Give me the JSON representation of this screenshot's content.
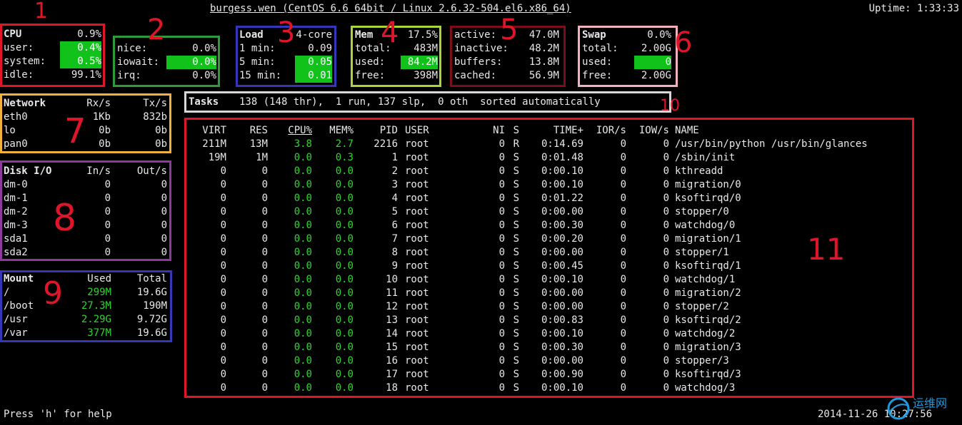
{
  "header": {
    "title": "burgess.wen (CentOS 6.6 64bit / Linux 2.6.32-504.el6.x86_64)",
    "uptime": "Uptime: 1:33:33"
  },
  "cpu": {
    "label": "CPU",
    "total": "0.9%",
    "rows": [
      {
        "k": "user:",
        "v": "0.4%"
      },
      {
        "k": "system:",
        "v": "0.5%"
      },
      {
        "k": "idle:",
        "v": "99.1%"
      }
    ]
  },
  "cpu2": {
    "rows": [
      {
        "k": "nice:",
        "v": "0.0%"
      },
      {
        "k": "iowait:",
        "v": "0.0%"
      },
      {
        "k": "irq:",
        "v": "0.0%"
      }
    ]
  },
  "load": {
    "label": "Load",
    "cores": "4-core",
    "rows": [
      {
        "k": "1 min:",
        "v": "0.09"
      },
      {
        "k": "5 min:",
        "v": "0.05"
      },
      {
        "k": "15 min:",
        "v": "0.01"
      }
    ]
  },
  "mem": {
    "label": "Mem",
    "pct": "17.5%",
    "rows": [
      {
        "k": "total:",
        "v": "483M"
      },
      {
        "k": "used:",
        "v": "84.2M"
      },
      {
        "k": "free:",
        "v": "398M"
      }
    ]
  },
  "mem2": {
    "rows": [
      {
        "k": "active:",
        "v": "47.0M"
      },
      {
        "k": "inactive:",
        "v": "48.2M"
      },
      {
        "k": "buffers:",
        "v": "13.8M"
      },
      {
        "k": "cached:",
        "v": "56.9M"
      }
    ]
  },
  "swap": {
    "label": "Swap",
    "pct": "0.0%",
    "rows": [
      {
        "k": "total:",
        "v": "2.00G"
      },
      {
        "k": "used:",
        "v": "0"
      },
      {
        "k": "free:",
        "v": "2.00G"
      }
    ]
  },
  "network": {
    "label": "Network",
    "rx": "Rx/s",
    "tx": "Tx/s",
    "rows": [
      {
        "k": "eth0",
        "rx": "1Kb",
        "tx": "832b"
      },
      {
        "k": "lo",
        "rx": "0b",
        "tx": "0b"
      },
      {
        "k": "pan0",
        "rx": "0b",
        "tx": "0b"
      }
    ]
  },
  "disk": {
    "label": "Disk I/O",
    "in": "In/s",
    "out": "Out/s",
    "rows": [
      {
        "k": "dm-0",
        "i": "0",
        "o": "0"
      },
      {
        "k": "dm-1",
        "i": "0",
        "o": "0"
      },
      {
        "k": "dm-2",
        "i": "0",
        "o": "0"
      },
      {
        "k": "dm-3",
        "i": "0",
        "o": "0"
      },
      {
        "k": "sda1",
        "i": "0",
        "o": "0"
      },
      {
        "k": "sda2",
        "i": "0",
        "o": "0"
      }
    ]
  },
  "mount": {
    "label": "Mount",
    "used": "Used",
    "total": "Total",
    "rows": [
      {
        "k": "/",
        "u": "299M",
        "t": "19.6G"
      },
      {
        "k": "/boot",
        "u": "27.3M",
        "t": "190M"
      },
      {
        "k": "/usr",
        "u": "2.29G",
        "t": "9.72G"
      },
      {
        "k": "/var",
        "u": "377M",
        "t": "19.6G"
      }
    ]
  },
  "tasks": {
    "label": "Tasks",
    "text": "138 (148 thr),  1 run, 137 slp,  0 oth  sorted automatically"
  },
  "proc": {
    "headers": {
      "virt": "VIRT",
      "res": "RES",
      "cpu": "CPU%",
      "mem": "MEM%",
      "pid": "PID",
      "user": "USER",
      "ni": "NI",
      "s": "S",
      "time": "TIME+",
      "ior": "IOR/s",
      "iow": "IOW/s",
      "name": "NAME"
    },
    "rows": [
      {
        "virt": "211M",
        "res": "13M",
        "cpu": "3.8",
        "mem": "2.7",
        "pid": "2216",
        "user": "root",
        "ni": "0",
        "s": "R",
        "time": "0:14.69",
        "ior": "0",
        "iow": "0",
        "name": "/usr/bin/python /usr/bin/glances"
      },
      {
        "virt": "19M",
        "res": "1M",
        "cpu": "0.0",
        "mem": "0.3",
        "pid": "1",
        "user": "root",
        "ni": "0",
        "s": "S",
        "time": "0:01.48",
        "ior": "0",
        "iow": "0",
        "name": "/sbin/init"
      },
      {
        "virt": "0",
        "res": "0",
        "cpu": "0.0",
        "mem": "0.0",
        "pid": "2",
        "user": "root",
        "ni": "0",
        "s": "S",
        "time": "0:00.10",
        "ior": "0",
        "iow": "0",
        "name": "kthreadd"
      },
      {
        "virt": "0",
        "res": "0",
        "cpu": "0.0",
        "mem": "0.0",
        "pid": "3",
        "user": "root",
        "ni": "0",
        "s": "S",
        "time": "0:00.10",
        "ior": "0",
        "iow": "0",
        "name": "migration/0"
      },
      {
        "virt": "0",
        "res": "0",
        "cpu": "0.0",
        "mem": "0.0",
        "pid": "4",
        "user": "root",
        "ni": "0",
        "s": "S",
        "time": "0:01.22",
        "ior": "0",
        "iow": "0",
        "name": "ksoftirqd/0"
      },
      {
        "virt": "0",
        "res": "0",
        "cpu": "0.0",
        "mem": "0.0",
        "pid": "5",
        "user": "root",
        "ni": "0",
        "s": "S",
        "time": "0:00.00",
        "ior": "0",
        "iow": "0",
        "name": "stopper/0"
      },
      {
        "virt": "0",
        "res": "0",
        "cpu": "0.0",
        "mem": "0.0",
        "pid": "6",
        "user": "root",
        "ni": "0",
        "s": "S",
        "time": "0:00.30",
        "ior": "0",
        "iow": "0",
        "name": "watchdog/0"
      },
      {
        "virt": "0",
        "res": "0",
        "cpu": "0.0",
        "mem": "0.0",
        "pid": "7",
        "user": "root",
        "ni": "0",
        "s": "S",
        "time": "0:00.20",
        "ior": "0",
        "iow": "0",
        "name": "migration/1"
      },
      {
        "virt": "0",
        "res": "0",
        "cpu": "0.0",
        "mem": "0.0",
        "pid": "8",
        "user": "root",
        "ni": "0",
        "s": "S",
        "time": "0:00.00",
        "ior": "0",
        "iow": "0",
        "name": "stopper/1"
      },
      {
        "virt": "0",
        "res": "0",
        "cpu": "0.0",
        "mem": "0.0",
        "pid": "9",
        "user": "root",
        "ni": "0",
        "s": "S",
        "time": "0:00.45",
        "ior": "0",
        "iow": "0",
        "name": "ksoftirqd/1"
      },
      {
        "virt": "0",
        "res": "0",
        "cpu": "0.0",
        "mem": "0.0",
        "pid": "10",
        "user": "root",
        "ni": "0",
        "s": "S",
        "time": "0:00.10",
        "ior": "0",
        "iow": "0",
        "name": "watchdog/1"
      },
      {
        "virt": "0",
        "res": "0",
        "cpu": "0.0",
        "mem": "0.0",
        "pid": "11",
        "user": "root",
        "ni": "0",
        "s": "S",
        "time": "0:00.00",
        "ior": "0",
        "iow": "0",
        "name": "migration/2"
      },
      {
        "virt": "0",
        "res": "0",
        "cpu": "0.0",
        "mem": "0.0",
        "pid": "12",
        "user": "root",
        "ni": "0",
        "s": "S",
        "time": "0:00.00",
        "ior": "0",
        "iow": "0",
        "name": "stopper/2"
      },
      {
        "virt": "0",
        "res": "0",
        "cpu": "0.0",
        "mem": "0.0",
        "pid": "13",
        "user": "root",
        "ni": "0",
        "s": "S",
        "time": "0:00.83",
        "ior": "0",
        "iow": "0",
        "name": "ksoftirqd/2"
      },
      {
        "virt": "0",
        "res": "0",
        "cpu": "0.0",
        "mem": "0.0",
        "pid": "14",
        "user": "root",
        "ni": "0",
        "s": "S",
        "time": "0:00.10",
        "ior": "0",
        "iow": "0",
        "name": "watchdog/2"
      },
      {
        "virt": "0",
        "res": "0",
        "cpu": "0.0",
        "mem": "0.0",
        "pid": "15",
        "user": "root",
        "ni": "0",
        "s": "S",
        "time": "0:00.30",
        "ior": "0",
        "iow": "0",
        "name": "migration/3"
      },
      {
        "virt": "0",
        "res": "0",
        "cpu": "0.0",
        "mem": "0.0",
        "pid": "16",
        "user": "root",
        "ni": "0",
        "s": "S",
        "time": "0:00.00",
        "ior": "0",
        "iow": "0",
        "name": "stopper/3"
      },
      {
        "virt": "0",
        "res": "0",
        "cpu": "0.0",
        "mem": "0.0",
        "pid": "17",
        "user": "root",
        "ni": "0",
        "s": "S",
        "time": "0:00.90",
        "ior": "0",
        "iow": "0",
        "name": "ksoftirqd/3"
      },
      {
        "virt": "0",
        "res": "0",
        "cpu": "0.0",
        "mem": "0.0",
        "pid": "18",
        "user": "root",
        "ni": "0",
        "s": "S",
        "time": "0:00.10",
        "ior": "0",
        "iow": "0",
        "name": "watchdog/3"
      }
    ]
  },
  "footer": {
    "help": "Press 'h' for help",
    "datetime": "2014-11-26 10:27:56"
  },
  "watermark": "运维网",
  "annotations": [
    "1",
    "2",
    "3",
    "4",
    "5",
    "6",
    "7",
    "8",
    "9",
    "10",
    "11"
  ],
  "colors": {
    "box_red": "#e0152a",
    "box_green": "#2e9b3a",
    "box_blue": "#3537b8",
    "box_lime": "#a6d638",
    "box_darkred": "#7a0f1b",
    "box_pink": "#f3b1c0",
    "box_orange": "#f2b13c",
    "box_purple": "#8c3a9c",
    "box_gray": "#d8d8d8",
    "highlight": "#11c21b",
    "value_green": "#2fd42f"
  }
}
